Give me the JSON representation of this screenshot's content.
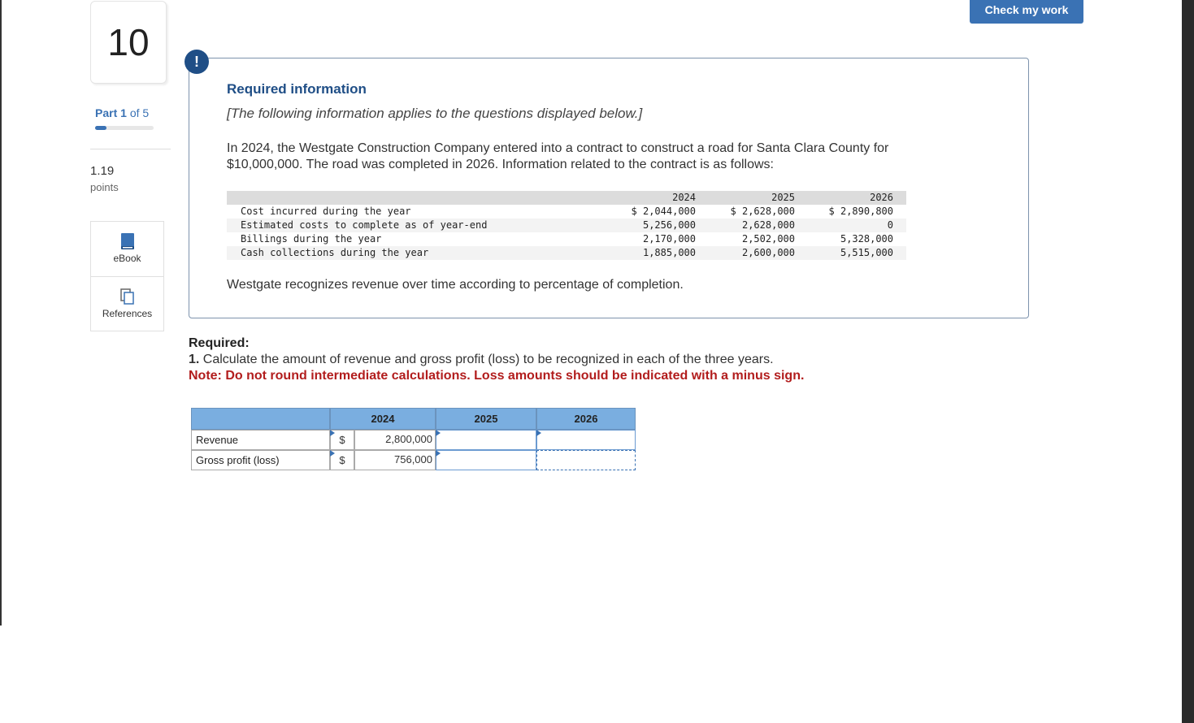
{
  "question": {
    "number": "10"
  },
  "part": {
    "label": "Part",
    "current": "1",
    "of_total": "of 5"
  },
  "points": {
    "value": "1.19",
    "label": "points"
  },
  "tools": {
    "ebook_label": "eBook",
    "references_label": "References"
  },
  "check_button": "Check my work",
  "info": {
    "alert_symbol": "!",
    "title": "Required information",
    "applies": "[The following information applies to the questions displayed below.]",
    "intro": "In 2024, the Westgate Construction Company entered into a contract to construct a road for Santa Clara County for $10,000,000. The road was completed in 2026. Information related to the contract is as follows:",
    "table": {
      "years": [
        "2024",
        "2025",
        "2026"
      ],
      "rows": [
        {
          "label": "Cost incurred during the year",
          "values": [
            "$ 2,044,000",
            "$ 2,628,000",
            "$ 2,890,800"
          ]
        },
        {
          "label": "Estimated costs to complete as of year-end",
          "values": [
            "5,256,000",
            "2,628,000",
            "0"
          ]
        },
        {
          "label": "Billings during the year",
          "values": [
            "2,170,000",
            "2,502,000",
            "5,328,000"
          ]
        },
        {
          "label": "Cash collections during the year",
          "values": [
            "1,885,000",
            "2,600,000",
            "5,515,000"
          ]
        }
      ]
    },
    "recognizes": "Westgate recognizes revenue over time according to percentage of completion."
  },
  "required": {
    "heading": "Required:",
    "q_number": "1.",
    "q_text": "Calculate the amount of revenue and gross profit (loss) to be recognized in each of the three years.",
    "note": "Note: Do not round intermediate calculations. Loss amounts should be indicated with a minus sign."
  },
  "answer": {
    "headers": [
      "2024",
      "2025",
      "2026"
    ],
    "rows": [
      {
        "label": "Revenue",
        "dollar": "$",
        "value_2024": "2,800,000",
        "value_2025": "",
        "value_2026": ""
      },
      {
        "label": "Gross profit (loss)",
        "dollar": "$",
        "value_2024": "756,000",
        "value_2025": "",
        "value_2026": ""
      }
    ]
  },
  "colors": {
    "accent": "#3a72b4",
    "title_blue": "#1f4e86",
    "note_red": "#b21d1d",
    "grid_header": "#7aaee0"
  }
}
